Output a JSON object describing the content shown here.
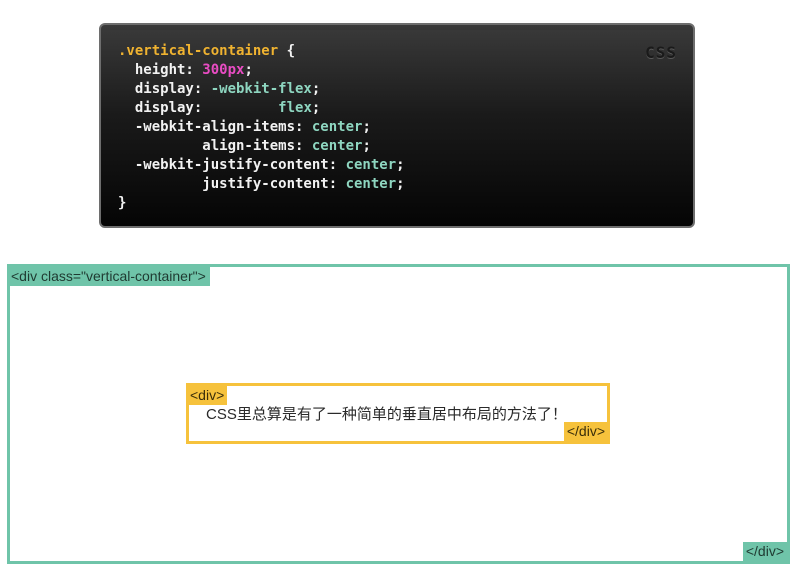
{
  "code_panel": {
    "language_tag": "CSS",
    "lines": [
      [
        {
          "t": ".vertical-container",
          "c": "sel"
        },
        {
          "t": " {",
          "c": ""
        }
      ],
      [
        {
          "t": "  height: ",
          "c": ""
        },
        {
          "t": "300px",
          "c": "num"
        },
        {
          "t": ";",
          "c": ""
        }
      ],
      [
        {
          "t": "  display: ",
          "c": ""
        },
        {
          "t": "-webkit-flex",
          "c": "val"
        },
        {
          "t": ";",
          "c": ""
        }
      ],
      [
        {
          "t": "  display:         ",
          "c": ""
        },
        {
          "t": "flex",
          "c": "val"
        },
        {
          "t": ";",
          "c": ""
        }
      ],
      [
        {
          "t": "  -webkit-align-items: ",
          "c": ""
        },
        {
          "t": "center",
          "c": "val"
        },
        {
          "t": ";",
          "c": ""
        }
      ],
      [
        {
          "t": "          align-items: ",
          "c": ""
        },
        {
          "t": "center",
          "c": "val"
        },
        {
          "t": ";",
          "c": ""
        }
      ],
      [
        {
          "t": "  -webkit-justify-content: ",
          "c": ""
        },
        {
          "t": "center",
          "c": "val"
        },
        {
          "t": ";",
          "c": ""
        }
      ],
      [
        {
          "t": "          justify-content: ",
          "c": ""
        },
        {
          "t": "center",
          "c": "val"
        },
        {
          "t": ";",
          "c": ""
        }
      ],
      [
        {
          "t": "}",
          "c": ""
        }
      ]
    ]
  },
  "demo": {
    "outer_open_tag": "<div class=\"vertical-container\">",
    "outer_close_tag": "</div>",
    "inner_open_tag": "<div>",
    "inner_close_tag": "</div>",
    "inner_text": "CSS里总算是有了一种简单的垂直居中布局的方法了！"
  },
  "colors": {
    "outer_border": "#6fc4a9",
    "inner_border": "#f6c23c",
    "selector": "#f0b330",
    "number": "#e94cc3",
    "value": "#8ed6c0"
  }
}
